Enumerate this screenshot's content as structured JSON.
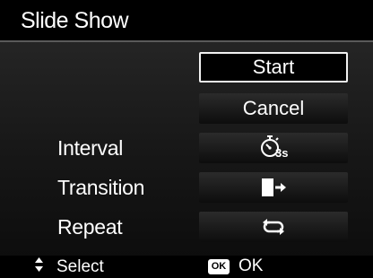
{
  "header": {
    "title": "Slide Show"
  },
  "menu": {
    "start_label": "Start",
    "cancel_label": "Cancel"
  },
  "settings": [
    {
      "label": "Interval",
      "value_text": "3s",
      "icon": "timer-icon"
    },
    {
      "label": "Transition",
      "icon": "transition-icon"
    },
    {
      "label": "Repeat",
      "icon": "repeat-icon"
    }
  ],
  "footer": {
    "select_label": "Select",
    "ok_badge": "OK",
    "ok_label": "OK"
  }
}
